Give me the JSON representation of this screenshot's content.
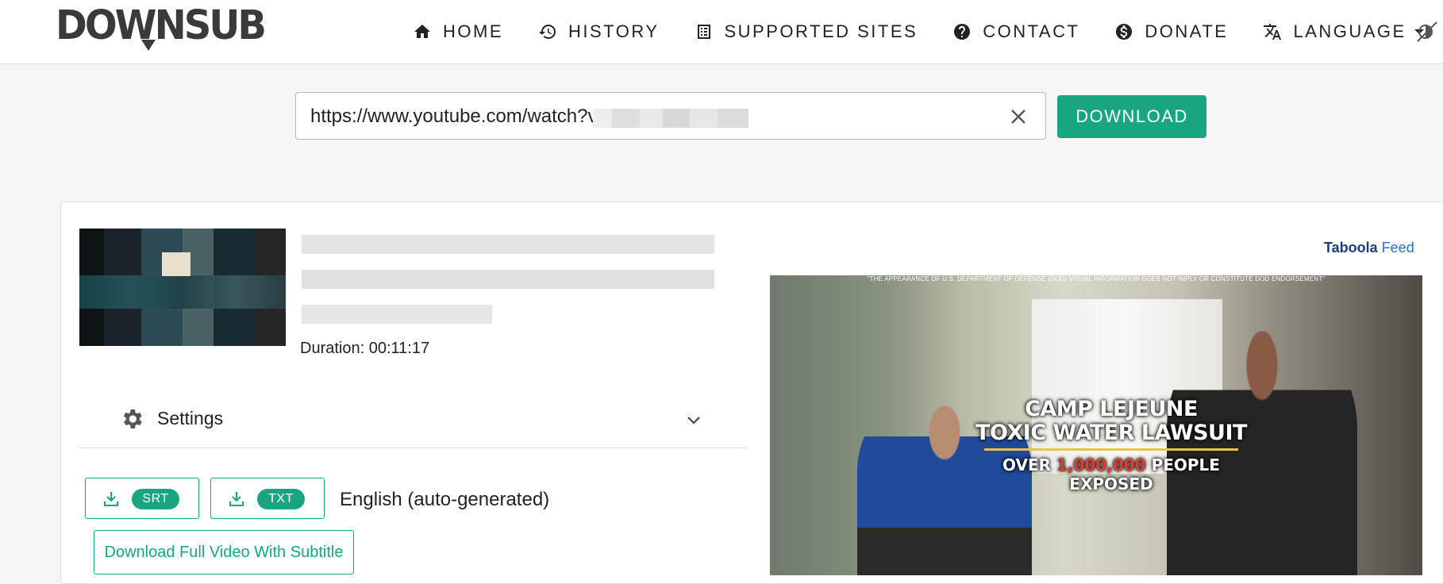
{
  "brand": {
    "logo_text": "DOWNSUB"
  },
  "nav": {
    "items": [
      {
        "label": "HOME",
        "icon": "home-icon"
      },
      {
        "label": "HISTORY",
        "icon": "history-icon"
      },
      {
        "label": "SUPPORTED SITES",
        "icon": "list-icon"
      },
      {
        "label": "CONTACT",
        "icon": "question-icon"
      },
      {
        "label": "DONATE",
        "icon": "dollar-icon"
      },
      {
        "label": "LANGUAGE",
        "icon": "translate-icon"
      }
    ],
    "theme_toggle_icon": "theme-toggle-icon"
  },
  "search": {
    "value": "https://www.youtube.com/watch?v",
    "clear_icon": "close-icon",
    "button_label": "DOWNLOAD"
  },
  "video": {
    "duration": "Duration: 00:11:17"
  },
  "settings": {
    "label": "Settings",
    "icon": "gear-icon",
    "chevron_icon": "chevron-down-icon"
  },
  "subtitles": {
    "formats": [
      {
        "label": "SRT",
        "icon": "download-icon"
      },
      {
        "label": "TXT",
        "icon": "download-icon"
      }
    ],
    "language": "English (auto-generated)",
    "full_video_button": "Download Full Video With Subtitle"
  },
  "ad": {
    "sponsor_brand": "Taboola",
    "sponsor_feed": "Feed",
    "disclaimer": "\"THE APPEARANCE OF U.S. DEPARTMENT OF DEFENSE (DOD) VISUAL INFORMATION DOES NOT IMPLY OR CONSTITUTE DOD ENDORSEMENT\"",
    "headline_1": "CAMP LEJEUNE",
    "headline_2": "TOXIC WATER LAWSUIT",
    "subline_prefix": "OVER ",
    "subline_number": "1,000,000",
    "subline_suffix": " PEOPLE EXPOSED"
  },
  "colors": {
    "accent": "#18a57f",
    "nav_text": "#222222",
    "taboola_blue": "#2a6fd4"
  }
}
